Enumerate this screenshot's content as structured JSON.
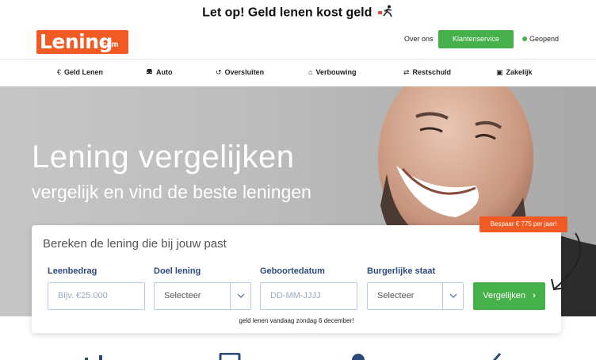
{
  "banner": {
    "warning": "Let op! Geld lenen kost geld"
  },
  "logo": {
    "word": "Lening",
    "suffix": ".com"
  },
  "top_nav": {
    "about": "Over ons",
    "service": "Klantenservice",
    "status": "Geopend"
  },
  "menu": [
    {
      "icon": "euro-icon",
      "glyph": "€",
      "label": "Geld Lenen"
    },
    {
      "icon": "car-icon",
      "glyph": "🚘",
      "label": "Auto"
    },
    {
      "icon": "undo-icon",
      "glyph": "↺",
      "label": "Oversluiten"
    },
    {
      "icon": "home-icon",
      "glyph": "⌂",
      "label": "Verbouwing"
    },
    {
      "icon": "retweet-icon",
      "glyph": "⇄",
      "label": "Restschuld"
    },
    {
      "icon": "briefcase-icon",
      "glyph": "▣",
      "label": "Zakelijk"
    }
  ],
  "hero": {
    "title": "Lening vergelijken",
    "subtitle": "vergelijk en vind de beste leningen"
  },
  "form": {
    "title": "Bereken de lening die bij jouw past",
    "amount": {
      "label": "Leenbedrag",
      "placeholder": "Bijv. €25.000"
    },
    "purpose": {
      "label": "Doel lening",
      "value": "Selecteer"
    },
    "birthdate": {
      "label": "Geboortedatum",
      "placeholder": "DD-MM-JJJJ"
    },
    "marital": {
      "label": "Burgerlijke staat",
      "value": "Selecteer"
    },
    "submit": "Vergelijken",
    "submit_icon": "›",
    "note": "geld lenen vandaag zondag 6 december!"
  },
  "promo_badge": "Bespaar € 775 per jaar!",
  "colors": {
    "brand": "#f15a22",
    "accent": "#46b04a",
    "label": "#2b4a7a"
  }
}
